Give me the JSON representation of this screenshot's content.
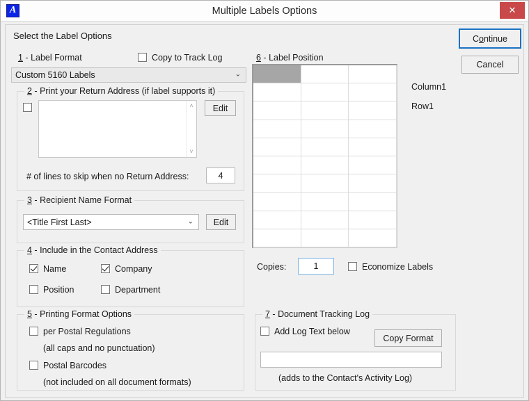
{
  "window": {
    "title": "Multiple Labels Options",
    "app_icon": "A",
    "close_icon": "✕"
  },
  "header": {
    "instruction": "Select the Label Options"
  },
  "buttons": {
    "continue": {
      "prefix": "C",
      "accel": "o",
      "suffix": "ntinue",
      "full": "Continue"
    },
    "cancel": "Cancel"
  },
  "section1": {
    "number": "1",
    "dash": " - ",
    "title": "Label Format",
    "copy_to_track_log": "Copy to Track Log",
    "copy_to_track_log_checked": false,
    "format_value": "Custom 5160 Labels",
    "format_options": [
      "Custom 5160 Labels"
    ],
    "dropdown_arrow": "⌄"
  },
  "section2": {
    "number": "2",
    "dash": " - ",
    "title": "Print your Return Address (if label supports it)",
    "enabled_checked": false,
    "address_text": "",
    "address_placeholder": "",
    "edit_label": "Edit",
    "scroll_up": "˄",
    "scroll_down": "˅",
    "skip_lines_label": "# of lines to skip when no Return Address:",
    "skip_lines_value": "4"
  },
  "section3": {
    "number": "3",
    "dash": " - ",
    "title": "Recipient Name Format",
    "name_format_value": "<Title First Last>",
    "name_format_options": [
      "<Title First Last>"
    ],
    "edit_label": "Edit",
    "dropdown_arrow": "⌄"
  },
  "section4": {
    "number": "4",
    "dash": " - ",
    "title": "Include in the Contact Address",
    "items": [
      {
        "label": "Name",
        "checked": true
      },
      {
        "label": "Company",
        "checked": true
      },
      {
        "label": "Position",
        "checked": false
      },
      {
        "label": "Department",
        "checked": false
      }
    ]
  },
  "section5": {
    "number": "5",
    "dash": " - ",
    "title": "Printing Format Options",
    "postal_regulations_label": "per Postal Regulations",
    "postal_regulations_checked": false,
    "postal_regulations_note": "(all caps and no punctuation)",
    "postal_barcodes_label": "Postal Barcodes",
    "postal_barcodes_checked": false,
    "postal_barcodes_note": "(not included on all document formats)"
  },
  "section6": {
    "number": "6",
    "dash": " - ",
    "title": "Label Position",
    "grid": {
      "columns": 3,
      "rows": 10,
      "selected_column": 1,
      "selected_row": 1
    },
    "column_readout": "Column1",
    "row_readout": "Row1",
    "copies_label": "Copies:",
    "copies_value": "1",
    "economize_label": "Economize Labels",
    "economize_checked": false
  },
  "section7": {
    "number": "7",
    "dash": " - ",
    "title": "Document Tracking Log",
    "add_log_text_label": "Add Log Text below",
    "add_log_text_checked": false,
    "copy_format_label": "Copy Format",
    "log_text_value": "",
    "log_text_placeholder": "",
    "note": "(adds to the Contact's Activity Log)"
  },
  "colors": {
    "accent": "#1a72c4",
    "close_red": "#c9484a",
    "app_blue": "#0a24e8",
    "grid_selected": "#a6a6a6",
    "dialog_bg": "#f0f0f0"
  }
}
